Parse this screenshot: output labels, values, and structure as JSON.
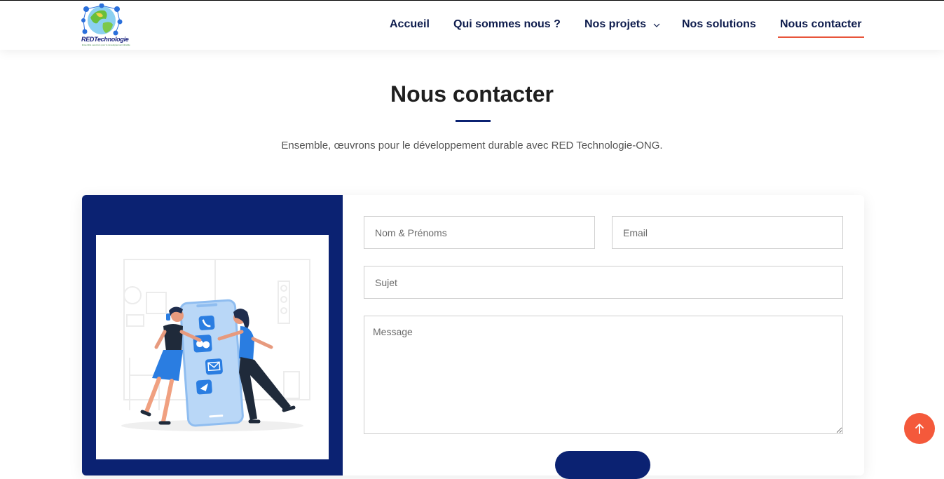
{
  "logo": {
    "text": "REDTechnologie",
    "tagline": "Ensemble oeuvrons pour le developpement durable"
  },
  "nav": {
    "items": [
      {
        "label": "Accueil"
      },
      {
        "label": "Qui sommes nous ?"
      },
      {
        "label": "Nos projets",
        "icon": "chevron-down-icon"
      },
      {
        "label": "Nos solutions"
      },
      {
        "label": "Nous contacter",
        "active": true
      }
    ]
  },
  "page": {
    "title": "Nous contacter",
    "subtitle": "Ensemble, œuvrons pour le développement durable avec RED Technologie-ONG."
  },
  "form": {
    "name_placeholder": "Nom & Prénoms",
    "email_placeholder": "Email",
    "subject_placeholder": "Sujet",
    "message_placeholder": "Message"
  },
  "colors": {
    "primary": "#0b2272",
    "accent": "#f4593b",
    "underline": "#e8553a"
  },
  "scroll_top": {
    "icon": "arrow-up-icon"
  }
}
